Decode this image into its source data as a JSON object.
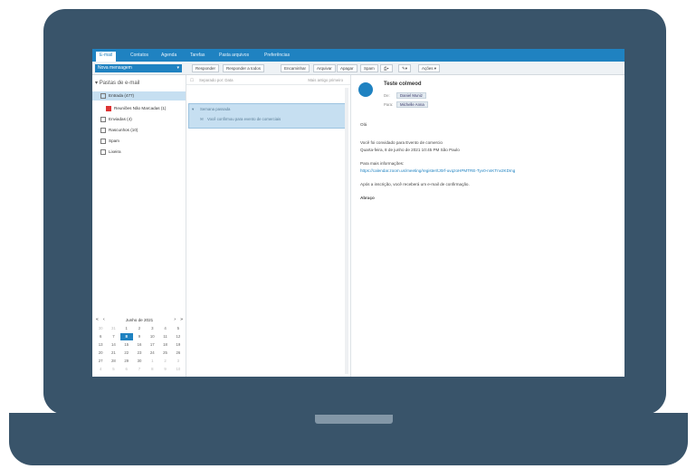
{
  "colors": {
    "laptop": "#39546a",
    "accent": "#1f82c1",
    "selection": "#c6dff1"
  },
  "nav": {
    "tabs": [
      "E-mail",
      "Contatos",
      "Agenda",
      "Tarefas",
      "Pasta arquivos",
      "Preferências"
    ]
  },
  "toolbar": {
    "new_label": "Nova mensagem",
    "buttons": [
      "Responder",
      "Responder a todos",
      "Encaminhar",
      "Arquivar",
      "Apagar",
      "Spam"
    ],
    "more_label": "Ações"
  },
  "sidebar": {
    "folders_title": "Pastas de e-mail",
    "folders": [
      {
        "label": "Entrada (477)",
        "selected": true
      },
      {
        "label": "Reuniões Não Marcadas (1)",
        "selected": false
      },
      {
        "label": "Enviadas (4)",
        "selected": false
      },
      {
        "label": "Rascunhos (10)",
        "selected": false
      },
      {
        "label": "Spam",
        "selected": false
      },
      {
        "label": "Lixeira",
        "selected": false
      }
    ],
    "calendar": {
      "month": "Junho de 2021",
      "days": [
        "30",
        "31",
        "1",
        "2",
        "3",
        "4",
        "5",
        "6",
        "7",
        "8",
        "9",
        "10",
        "11",
        "12",
        "13",
        "14",
        "15",
        "16",
        "17",
        "18",
        "19",
        "20",
        "21",
        "22",
        "23",
        "24",
        "25",
        "26",
        "27",
        "28",
        "29",
        "30",
        "1",
        "2",
        "3",
        "4",
        "5",
        "6",
        "7",
        "8",
        "9",
        "10"
      ],
      "today": "8"
    }
  },
  "message_list": {
    "sort_label": "Separado por: Data",
    "sort_order": "Mais antigo primeiro",
    "group_label": "Semana passada",
    "item_preview": "Você confirmou para evento de comerciais"
  },
  "reader": {
    "subject": "Teste colmeod",
    "from_label": "De:",
    "from_value": "Daniel Muniz",
    "to_label": "Para:",
    "to_value": "Michelle Anna",
    "greeting": "Olá",
    "line1": "Você foi convidado para Evento de comercio",
    "line2": "Quarta-feira, 8 de junho de 2021 10:45 PM São Paulo",
    "line3": "Para mais informações:",
    "link": "https://calendar.zoom.us/meeting/register/tJ0rf-uvqzoHPMTRE-Tyv0-nnKTnv2KDmg",
    "line4": "Após a inscrição, você receberá um e-mail de confirmação.",
    "sign": "Abraço"
  }
}
